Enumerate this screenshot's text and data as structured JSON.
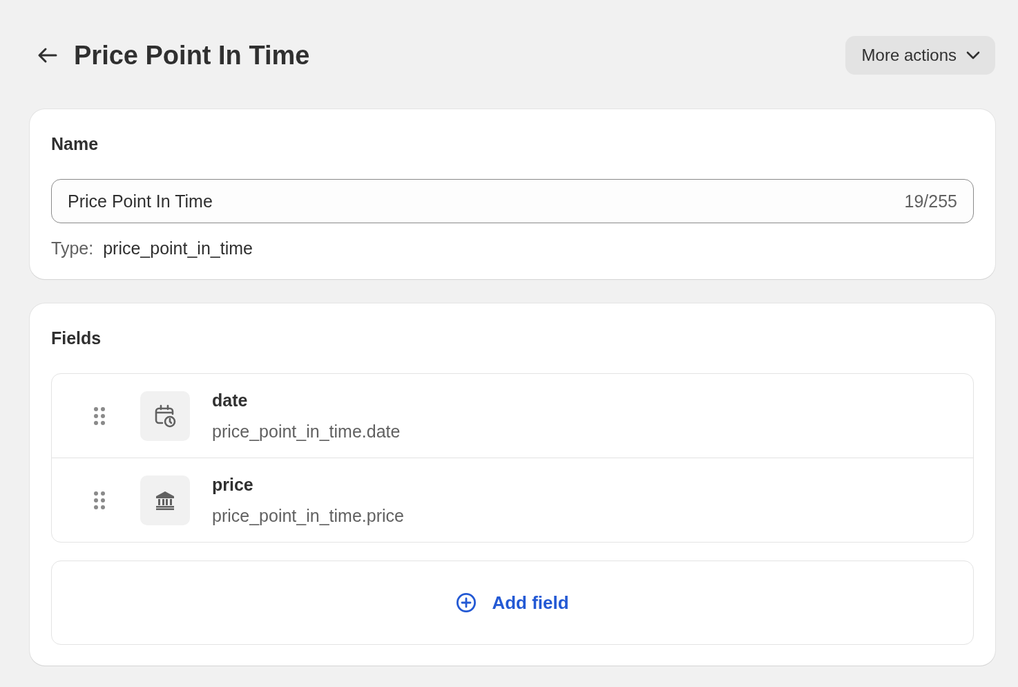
{
  "header": {
    "title": "Price Point In Time",
    "more_actions": "More actions"
  },
  "name_card": {
    "heading": "Name",
    "name_field": {
      "value": "Price Point In Time",
      "counter": "19/255"
    },
    "type_label": "Type:",
    "type_value": "price_point_in_time"
  },
  "fields_card": {
    "heading": "Fields",
    "fields": [
      {
        "kind": "date",
        "name": "date",
        "key": "price_point_in_time.date"
      },
      {
        "kind": "money",
        "name": "price",
        "key": "price_point_in_time.price"
      }
    ],
    "add_field": "Add field"
  }
}
